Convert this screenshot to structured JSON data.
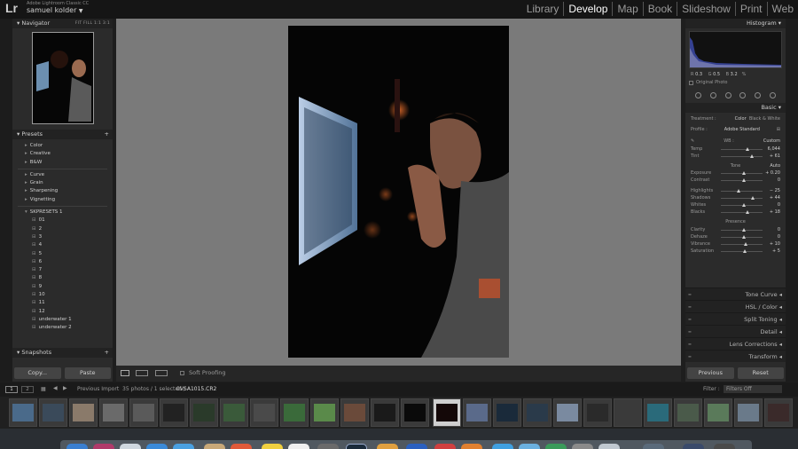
{
  "app": {
    "logo": "Lr",
    "name": "Adobe Lightroom Classic CC",
    "user": "samuel kolder",
    "user_caret": "▼"
  },
  "modules": [
    "Library",
    "Develop",
    "Map",
    "Book",
    "Slideshow",
    "Print",
    "Web"
  ],
  "active_module": "Develop",
  "navigator": {
    "title": "Navigator",
    "zoom": "FIT  FILL  1:1  3:1"
  },
  "presets": {
    "title": "Presets",
    "groups_a": [
      "Color",
      "Creative",
      "B&W"
    ],
    "groups_b": [
      "Curve",
      "Grain",
      "Sharpening",
      "Vignetting"
    ],
    "user_group": "SKPRESETS 1",
    "user_items": [
      "01",
      "2",
      "3",
      "4",
      "5",
      "6",
      "7",
      "8",
      "9",
      "10",
      "11",
      "12",
      "underwater 1",
      "underwater 2"
    ]
  },
  "snapshots": {
    "title": "Snapshots"
  },
  "left_buttons": {
    "copy": "Copy...",
    "paste": "Paste"
  },
  "toolbar": {
    "soft_proofing": "Soft Proofing"
  },
  "histogram": {
    "title": "Histogram",
    "r_label": "R",
    "r": "0.3",
    "g_label": "G",
    "g": "0.5",
    "b_label": "B",
    "b": "3.2",
    "pct": "%",
    "original_photo": "Original Photo"
  },
  "basic": {
    "title": "Basic",
    "treatment_label": "Treatment :",
    "treatment_color": "Color",
    "treatment_bw": "Black & White",
    "profile_label": "Profile :",
    "profile_value": "Adobe Standard",
    "wb_label": "WB :",
    "wb_value": "Custom",
    "temp_label": "Temp",
    "temp": "6,044",
    "tint_label": "Tint",
    "tint": "+ 61",
    "tone_label": "Tone",
    "auto_label": "Auto",
    "exposure_label": "Exposure",
    "exposure": "+ 0.20",
    "contrast_label": "Contrast",
    "contrast": "0",
    "highlights_label": "Highlights",
    "highlights": "− 25",
    "shadows_label": "Shadows",
    "shadows": "+ 44",
    "whites_label": "Whites",
    "whites": "0",
    "blacks_label": "Blacks",
    "blacks": "+ 18",
    "presence_label": "Presence",
    "clarity_label": "Clarity",
    "clarity": "0",
    "dehaze_label": "Dehaze",
    "dehaze": "0",
    "vibrance_label": "Vibrance",
    "vibrance": "+ 10",
    "saturation_label": "Saturation",
    "saturation": "+ 5"
  },
  "panels": [
    "Tone Curve",
    "HSL / Color",
    "Split Toning",
    "Detail",
    "Lens Corrections",
    "Transform"
  ],
  "right_buttons": {
    "previous": "Previous",
    "reset": "Reset"
  },
  "strip_bar": {
    "page1": "1",
    "page2": "2",
    "source": "Previous Import",
    "count": "35 photos / 1 selected /",
    "filename": "0VSA1015.CR2",
    "filter_label": "Filter :",
    "filter_value": "Filters Off"
  },
  "colors": {
    "accent": "#ffffff",
    "panel": "#2b2b2b",
    "center": "#7a7a7a"
  }
}
